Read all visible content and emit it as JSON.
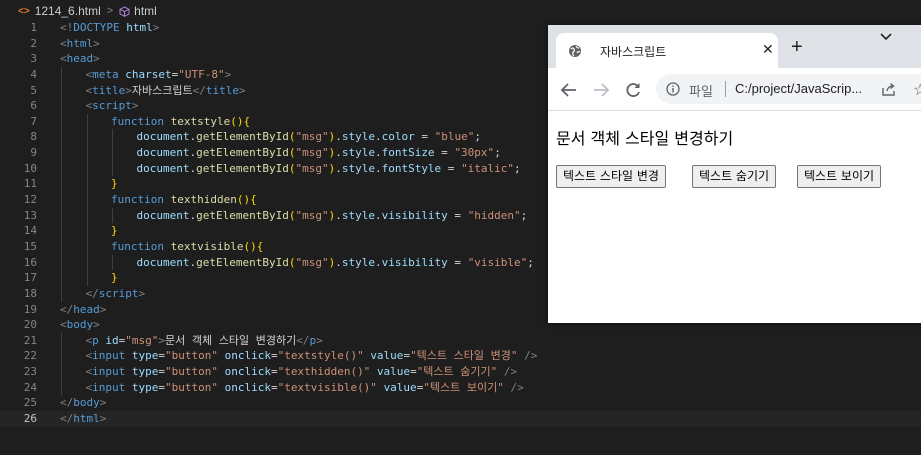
{
  "breadcrumb": {
    "file": "1214_6.html",
    "separator": ">",
    "symbol": "html"
  },
  "editor": {
    "active_line": 26,
    "lines": [
      {
        "n": "1",
        "indent": 0,
        "tokens": [
          [
            "t",
            "<!"
          ],
          [
            "tn",
            "DOCTYPE"
          ],
          [
            "tx",
            " "
          ],
          [
            "an",
            "html"
          ],
          [
            "t",
            ">"
          ]
        ]
      },
      {
        "n": "2",
        "indent": 0,
        "tokens": [
          [
            "t",
            "<"
          ],
          [
            "tn",
            "html"
          ],
          [
            "t",
            ">"
          ]
        ]
      },
      {
        "n": "3",
        "indent": 0,
        "tokens": [
          [
            "t",
            "<"
          ],
          [
            "tn",
            "head"
          ],
          [
            "t",
            ">"
          ]
        ]
      },
      {
        "n": "4",
        "indent": 1,
        "tokens": [
          [
            "t",
            "<"
          ],
          [
            "tn",
            "meta"
          ],
          [
            "tx",
            " "
          ],
          [
            "an",
            "charset"
          ],
          [
            "tx",
            "="
          ],
          [
            "sv",
            "\"UTF-8\""
          ],
          [
            "t",
            ">"
          ]
        ]
      },
      {
        "n": "5",
        "indent": 1,
        "tokens": [
          [
            "t",
            "<"
          ],
          [
            "tn",
            "title"
          ],
          [
            "t",
            ">"
          ],
          [
            "tx",
            "자바스크립트"
          ],
          [
            "t",
            "</"
          ],
          [
            "tn",
            "title"
          ],
          [
            "t",
            ">"
          ]
        ]
      },
      {
        "n": "6",
        "indent": 1,
        "tokens": [
          [
            "t",
            "<"
          ],
          [
            "tn",
            "script"
          ],
          [
            "t",
            ">"
          ]
        ]
      },
      {
        "n": "7",
        "indent": 2,
        "tokens": [
          [
            "kw",
            "function"
          ],
          [
            "tx",
            " "
          ],
          [
            "fn",
            "textstyle"
          ],
          [
            "br",
            "(){"
          ]
        ]
      },
      {
        "n": "8",
        "indent": 3,
        "tokens": [
          [
            "an",
            "document"
          ],
          [
            "tx",
            "."
          ],
          [
            "fn",
            "getElementById"
          ],
          [
            "br",
            "("
          ],
          [
            "sv",
            "\"msg\""
          ],
          [
            "br",
            ")"
          ],
          [
            "tx",
            "."
          ],
          [
            "an",
            "style"
          ],
          [
            "tx",
            "."
          ],
          [
            "an",
            "color"
          ],
          [
            "tx",
            " = "
          ],
          [
            "sv",
            "\"blue\""
          ],
          [
            "tx",
            ";"
          ]
        ]
      },
      {
        "n": "9",
        "indent": 3,
        "tokens": [
          [
            "an",
            "document"
          ],
          [
            "tx",
            "."
          ],
          [
            "fn",
            "getElementById"
          ],
          [
            "br",
            "("
          ],
          [
            "sv",
            "\"msg\""
          ],
          [
            "br",
            ")"
          ],
          [
            "tx",
            "."
          ],
          [
            "an",
            "style"
          ],
          [
            "tx",
            "."
          ],
          [
            "an",
            "fontSize"
          ],
          [
            "tx",
            " = "
          ],
          [
            "sv",
            "\"30px\""
          ],
          [
            "tx",
            ";"
          ]
        ]
      },
      {
        "n": "10",
        "indent": 3,
        "tokens": [
          [
            "an",
            "document"
          ],
          [
            "tx",
            "."
          ],
          [
            "fn",
            "getElementById"
          ],
          [
            "br",
            "("
          ],
          [
            "sv",
            "\"msg\""
          ],
          [
            "br",
            ")"
          ],
          [
            "tx",
            "."
          ],
          [
            "an",
            "style"
          ],
          [
            "tx",
            "."
          ],
          [
            "an",
            "fontStyle"
          ],
          [
            "tx",
            " = "
          ],
          [
            "sv",
            "\"italic\""
          ],
          [
            "tx",
            ";"
          ]
        ]
      },
      {
        "n": "11",
        "indent": 2,
        "tokens": [
          [
            "br",
            "}"
          ]
        ]
      },
      {
        "n": "12",
        "indent": 2,
        "tokens": [
          [
            "kw",
            "function"
          ],
          [
            "tx",
            " "
          ],
          [
            "fn",
            "texthidden"
          ],
          [
            "br",
            "(){"
          ]
        ]
      },
      {
        "n": "13",
        "indent": 3,
        "tokens": [
          [
            "an",
            "document"
          ],
          [
            "tx",
            "."
          ],
          [
            "fn",
            "getElementById"
          ],
          [
            "br",
            "("
          ],
          [
            "sv",
            "\"msg\""
          ],
          [
            "br",
            ")"
          ],
          [
            "tx",
            "."
          ],
          [
            "an",
            "style"
          ],
          [
            "tx",
            "."
          ],
          [
            "an",
            "visibility"
          ],
          [
            "tx",
            " = "
          ],
          [
            "sv",
            "\"hidden\""
          ],
          [
            "tx",
            ";"
          ]
        ]
      },
      {
        "n": "14",
        "indent": 2,
        "tokens": [
          [
            "br",
            "}"
          ]
        ]
      },
      {
        "n": "15",
        "indent": 2,
        "tokens": [
          [
            "kw",
            "function"
          ],
          [
            "tx",
            " "
          ],
          [
            "fn",
            "textvisible"
          ],
          [
            "br",
            "(){"
          ]
        ]
      },
      {
        "n": "16",
        "indent": 3,
        "tokens": [
          [
            "an",
            "document"
          ],
          [
            "tx",
            "."
          ],
          [
            "fn",
            "getElementById"
          ],
          [
            "br",
            "("
          ],
          [
            "sv",
            "\"msg\""
          ],
          [
            "br",
            ")"
          ],
          [
            "tx",
            "."
          ],
          [
            "an",
            "style"
          ],
          [
            "tx",
            "."
          ],
          [
            "an",
            "visibility"
          ],
          [
            "tx",
            " = "
          ],
          [
            "sv",
            "\"visible\""
          ],
          [
            "tx",
            ";"
          ]
        ]
      },
      {
        "n": "17",
        "indent": 2,
        "tokens": [
          [
            "br",
            "}"
          ]
        ]
      },
      {
        "n": "18",
        "indent": 1,
        "tokens": [
          [
            "t",
            "</"
          ],
          [
            "tn",
            "script"
          ],
          [
            "t",
            ">"
          ]
        ]
      },
      {
        "n": "19",
        "indent": 0,
        "tokens": [
          [
            "t",
            "</"
          ],
          [
            "tn",
            "head"
          ],
          [
            "t",
            ">"
          ]
        ]
      },
      {
        "n": "20",
        "indent": 0,
        "tokens": [
          [
            "t",
            "<"
          ],
          [
            "tn",
            "body"
          ],
          [
            "t",
            ">"
          ]
        ]
      },
      {
        "n": "21",
        "indent": 1,
        "tokens": [
          [
            "t",
            "<"
          ],
          [
            "tn",
            "p"
          ],
          [
            "tx",
            " "
          ],
          [
            "an",
            "id"
          ],
          [
            "tx",
            "="
          ],
          [
            "sv",
            "\"msg\""
          ],
          [
            "t",
            ">"
          ],
          [
            "tx",
            "문서 객체 스타일 변경하기"
          ],
          [
            "t",
            "</"
          ],
          [
            "tn",
            "p"
          ],
          [
            "t",
            ">"
          ]
        ]
      },
      {
        "n": "22",
        "indent": 1,
        "tokens": [
          [
            "t",
            "<"
          ],
          [
            "tn",
            "input"
          ],
          [
            "tx",
            " "
          ],
          [
            "an",
            "type"
          ],
          [
            "tx",
            "="
          ],
          [
            "sv",
            "\"button\""
          ],
          [
            "tx",
            " "
          ],
          [
            "an",
            "onclick"
          ],
          [
            "tx",
            "="
          ],
          [
            "sv",
            "\"textstyle()\""
          ],
          [
            "tx",
            " "
          ],
          [
            "an",
            "value"
          ],
          [
            "tx",
            "="
          ],
          [
            "sv",
            "\"텍스트 스타일 변경\""
          ],
          [
            "tx",
            " "
          ],
          [
            "t",
            "/>"
          ]
        ]
      },
      {
        "n": "23",
        "indent": 1,
        "tokens": [
          [
            "t",
            "<"
          ],
          [
            "tn",
            "input"
          ],
          [
            "tx",
            " "
          ],
          [
            "an",
            "type"
          ],
          [
            "tx",
            "="
          ],
          [
            "sv",
            "\"button\""
          ],
          [
            "tx",
            " "
          ],
          [
            "an",
            "onclick"
          ],
          [
            "tx",
            "="
          ],
          [
            "sv",
            "\"texthidden()\""
          ],
          [
            "tx",
            " "
          ],
          [
            "an",
            "value"
          ],
          [
            "tx",
            "="
          ],
          [
            "sv",
            "\"텍스트 숨기기\""
          ],
          [
            "tx",
            " "
          ],
          [
            "t",
            "/>"
          ]
        ]
      },
      {
        "n": "24",
        "indent": 1,
        "tokens": [
          [
            "t",
            "<"
          ],
          [
            "tn",
            "input"
          ],
          [
            "tx",
            " "
          ],
          [
            "an",
            "type"
          ],
          [
            "tx",
            "="
          ],
          [
            "sv",
            "\"button\""
          ],
          [
            "tx",
            " "
          ],
          [
            "an",
            "onclick"
          ],
          [
            "tx",
            "="
          ],
          [
            "sv",
            "\"textvisible()\""
          ],
          [
            "tx",
            " "
          ],
          [
            "an",
            "value"
          ],
          [
            "tx",
            "="
          ],
          [
            "sv",
            "\"텍스트 보이기\""
          ],
          [
            "tx",
            " "
          ],
          [
            "t",
            "/>"
          ]
        ]
      },
      {
        "n": "25",
        "indent": 0,
        "tokens": [
          [
            "t",
            "</"
          ],
          [
            "tn",
            "body"
          ],
          [
            "t",
            ">"
          ]
        ]
      },
      {
        "n": "26",
        "indent": 0,
        "tokens": [
          [
            "t",
            "</"
          ],
          [
            "tn",
            "html"
          ],
          [
            "t",
            ">"
          ]
        ]
      }
    ]
  },
  "browser": {
    "tab_title": "자바스크립트",
    "tab_close": "✕",
    "new_tab": "+",
    "omnibox_label": "파일",
    "url": "C:/project/JavaScrip...",
    "page_text": "문서 객체 스타일 변경하기",
    "buttons": [
      "텍스트 스타일 변경",
      "텍스트 숨기기",
      "텍스트 보이기"
    ]
  },
  "colors": {
    "editor_bg": "#1e1e1e",
    "tag": "#569cd6",
    "attr": "#9cdcfe",
    "string": "#ce9178",
    "function": "#dcdcaa",
    "brace": "#ffd700"
  }
}
